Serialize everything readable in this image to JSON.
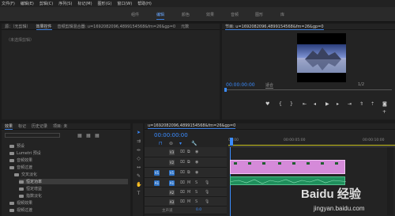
{
  "menu": [
    "文件(F)",
    "编辑(E)",
    "剪辑(C)",
    "序列(S)",
    "标记(M)",
    "图形(G)",
    "窗口(W)",
    "帮助(H)"
  ],
  "workspaces": [
    "组件",
    "编辑",
    "颜色",
    "效果",
    "音频",
    "图形",
    "库"
  ],
  "source_panel": {
    "tabs": [
      "源：（无剪辑）",
      "效果控件",
      "音频剪辑混合器: u=1692082096,4899154568&fm=26&gp=0"
    ],
    "extra_tab": "元数",
    "empty_label": "（未选择剪辑）"
  },
  "program_panel": {
    "title": "节目: u=1692082096,4899154568&fm=26&gp=0",
    "timecode": "00:00:00:00",
    "fit": "适合",
    "ratio": "1/2"
  },
  "effects_panel": {
    "tabs": [
      "效果",
      "标记",
      "历史记录",
      "项目: 未"
    ],
    "items": [
      "预设",
      "Lumetri 预设",
      "音频效果",
      "音频过渡",
      "交叉淡化",
      "恒定功率",
      "恒定增益",
      "指数淡化",
      "视频效果",
      "视频过渡"
    ]
  },
  "timeline": {
    "title": "u=1692082096,4899154568&fm=26&gp=0",
    "timecode": "00:00:00:00",
    "ruler": [
      "00:00",
      "00:00:05:00",
      "00:00:10:00"
    ],
    "video_tracks": [
      "V3",
      "V2",
      "V1"
    ],
    "audio_tracks": [
      "A1",
      "A2",
      "A3"
    ],
    "master": "主声道",
    "master_value": "0.0"
  },
  "watermark": {
    "main": "Baidu 经验",
    "url": "jingyan.baidu.com"
  },
  "colors": {
    "accent": "#3b8cff",
    "clip": "#d58ad9",
    "audio": "#1f8f5c"
  }
}
